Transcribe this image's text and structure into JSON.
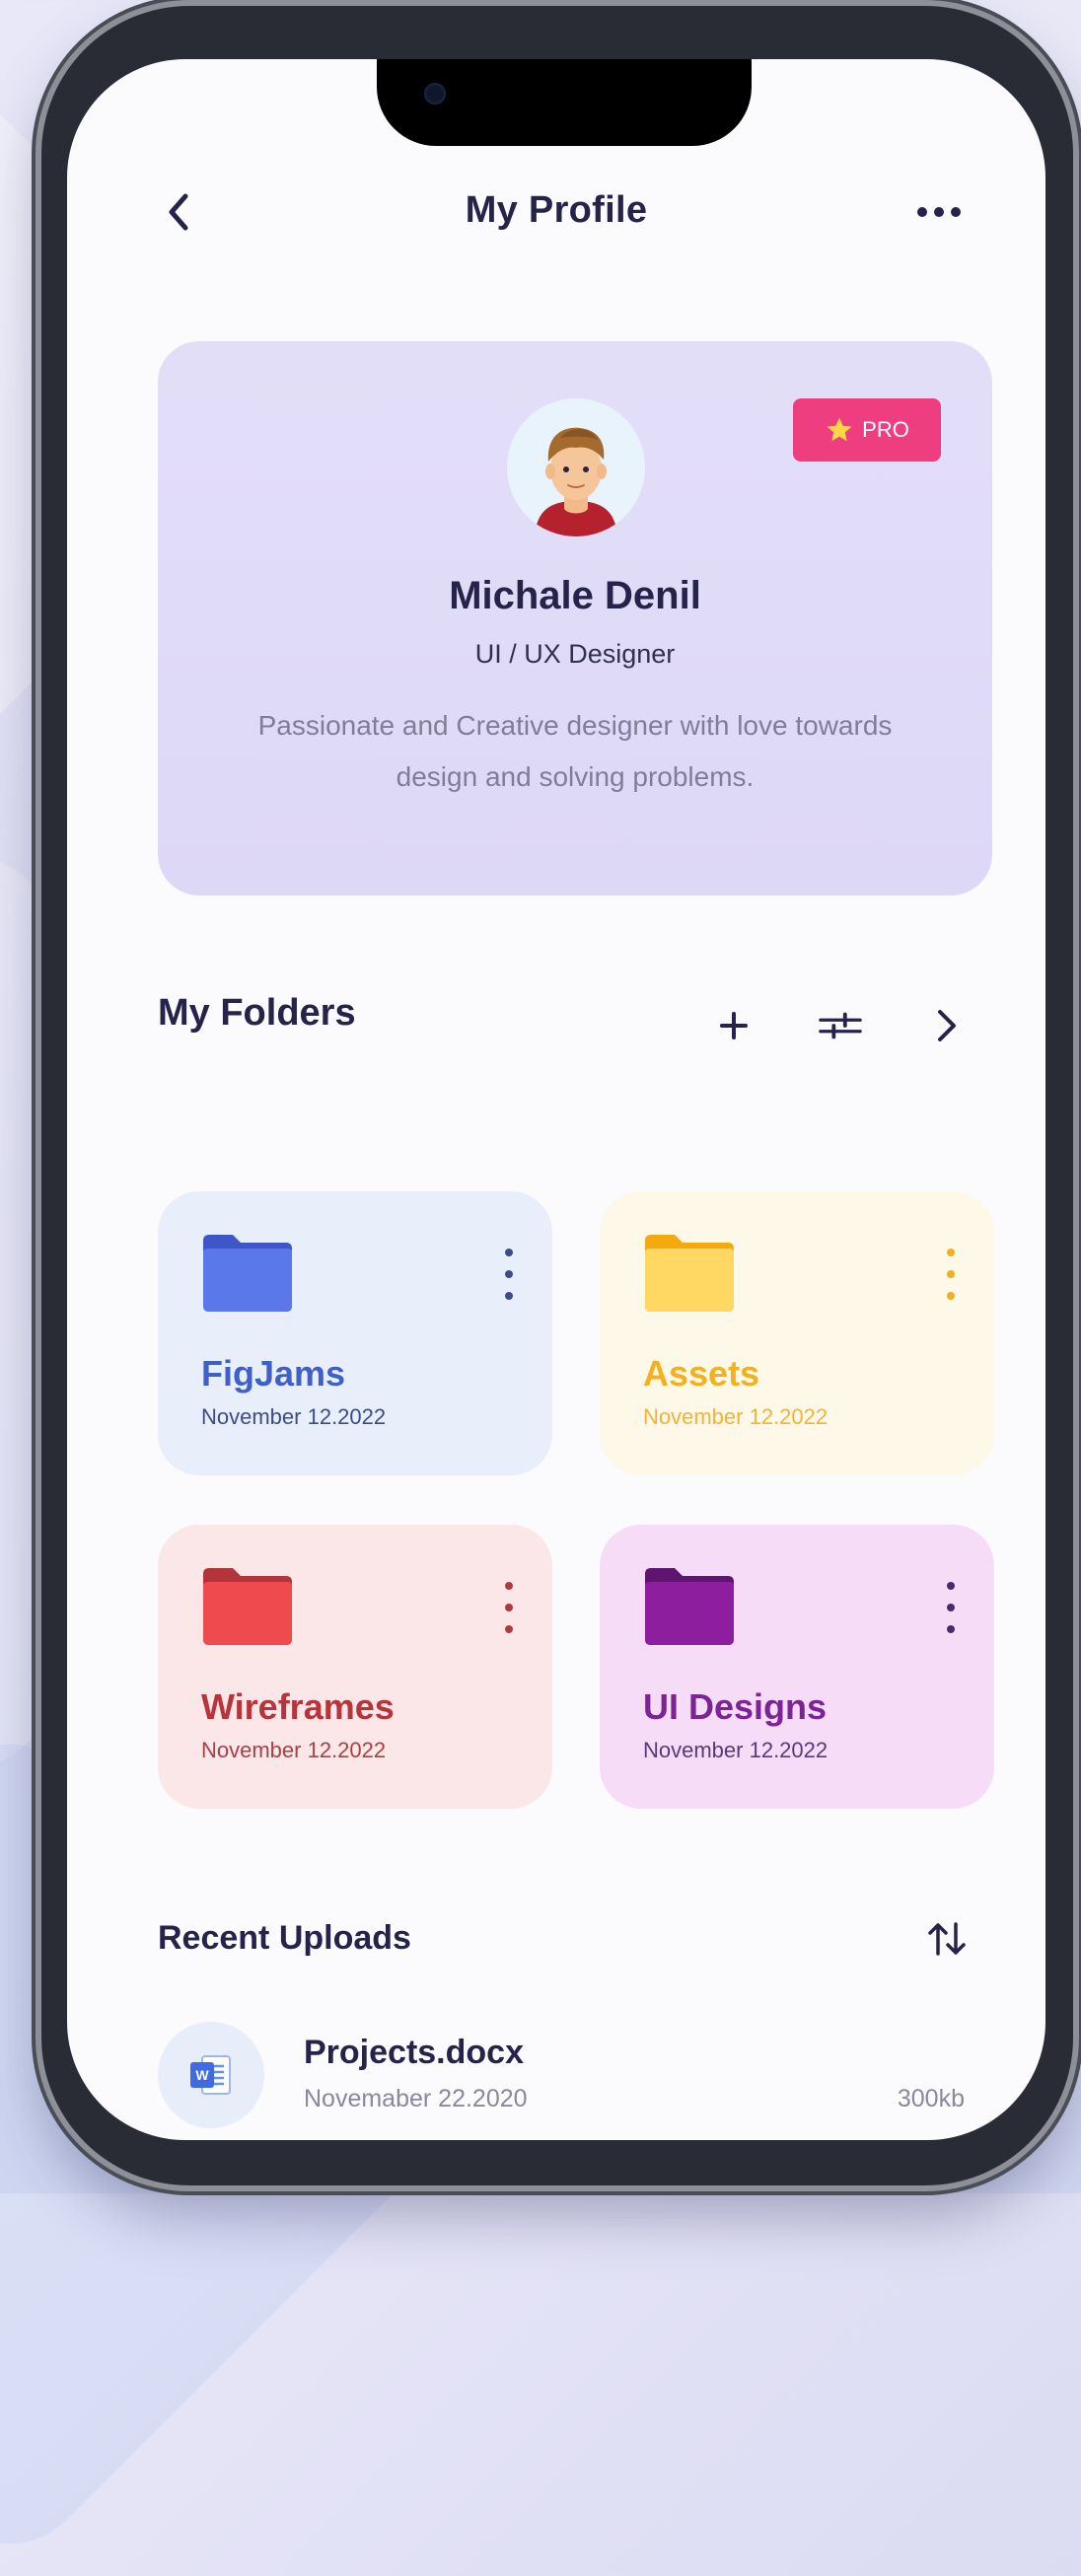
{
  "header": {
    "title": "My Profile",
    "back_icon": "chevron-left-icon",
    "more_icon": "more-horizontal-icon"
  },
  "profile": {
    "name": "Michale Denil",
    "role": "UI / UX Designer",
    "bio": "Passionate and Creative designer with love towards design and solving problems.",
    "badge": "PRO",
    "badge_color": "#ee3e7f",
    "card_color": "#e2ddf8"
  },
  "folders_section": {
    "title": "My Folders",
    "actions": [
      "plus-icon",
      "filter-sliders-icon",
      "chevron-right-icon"
    ],
    "folders": [
      {
        "name": "FigJams",
        "date": "November 12.2022",
        "color": "#4f6de0",
        "bg": "#e8effb"
      },
      {
        "name": "Assets",
        "date": "November 12.2022",
        "color": "#f5b21b",
        "bg": "#fdf8e7"
      },
      {
        "name": "Wireframes",
        "date": "November 12.2022",
        "color": "#c8343a",
        "bg": "#fbe7e8"
      },
      {
        "name": "UI Designs",
        "date": "November 12.2022",
        "color": "#8a1f99",
        "bg": "#f7dcf7"
      }
    ]
  },
  "uploads": {
    "title": "Recent Uploads",
    "sort_icon": "sort-arrows-icon",
    "files": [
      {
        "name": "Projects.docx",
        "date": "Novemaber 22.2020",
        "size": "300kb",
        "icon": "word-doc-icon"
      }
    ]
  }
}
